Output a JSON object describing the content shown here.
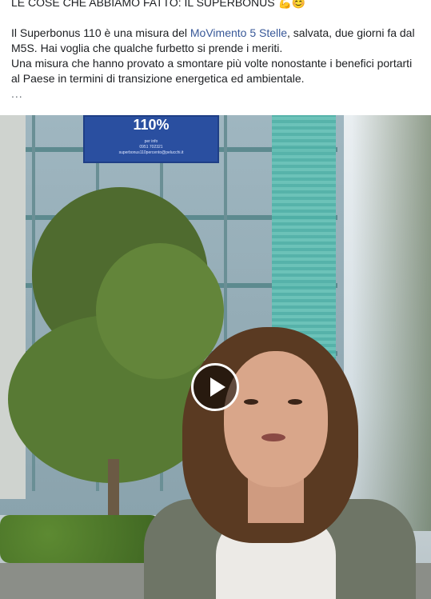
{
  "post": {
    "title": "LE COSE CHE ABBIAMO FATTO: IL SUPERBONUS 💪😊",
    "line1_prefix": "Il Superbonus 110 è una misura del ",
    "line1_link": "MoVimento 5 Stelle",
    "line1_suffix": ", salvata, due giorni fa dal",
    "line2": "M5S. Hai voglia che qualche furbetto si prende i meriti.",
    "line3": "Una misura che hanno provato a smontare più volte nonostante i benefici portarti",
    "line4": "al Paese in termini di transizione energetica ed ambientale.",
    "see_more": "..."
  },
  "video": {
    "banner_title": "110%",
    "banner_sub": "per info\n0951 702321\nsuperbonus110percento@pelucchi.it",
    "play_icon": "play-icon"
  }
}
